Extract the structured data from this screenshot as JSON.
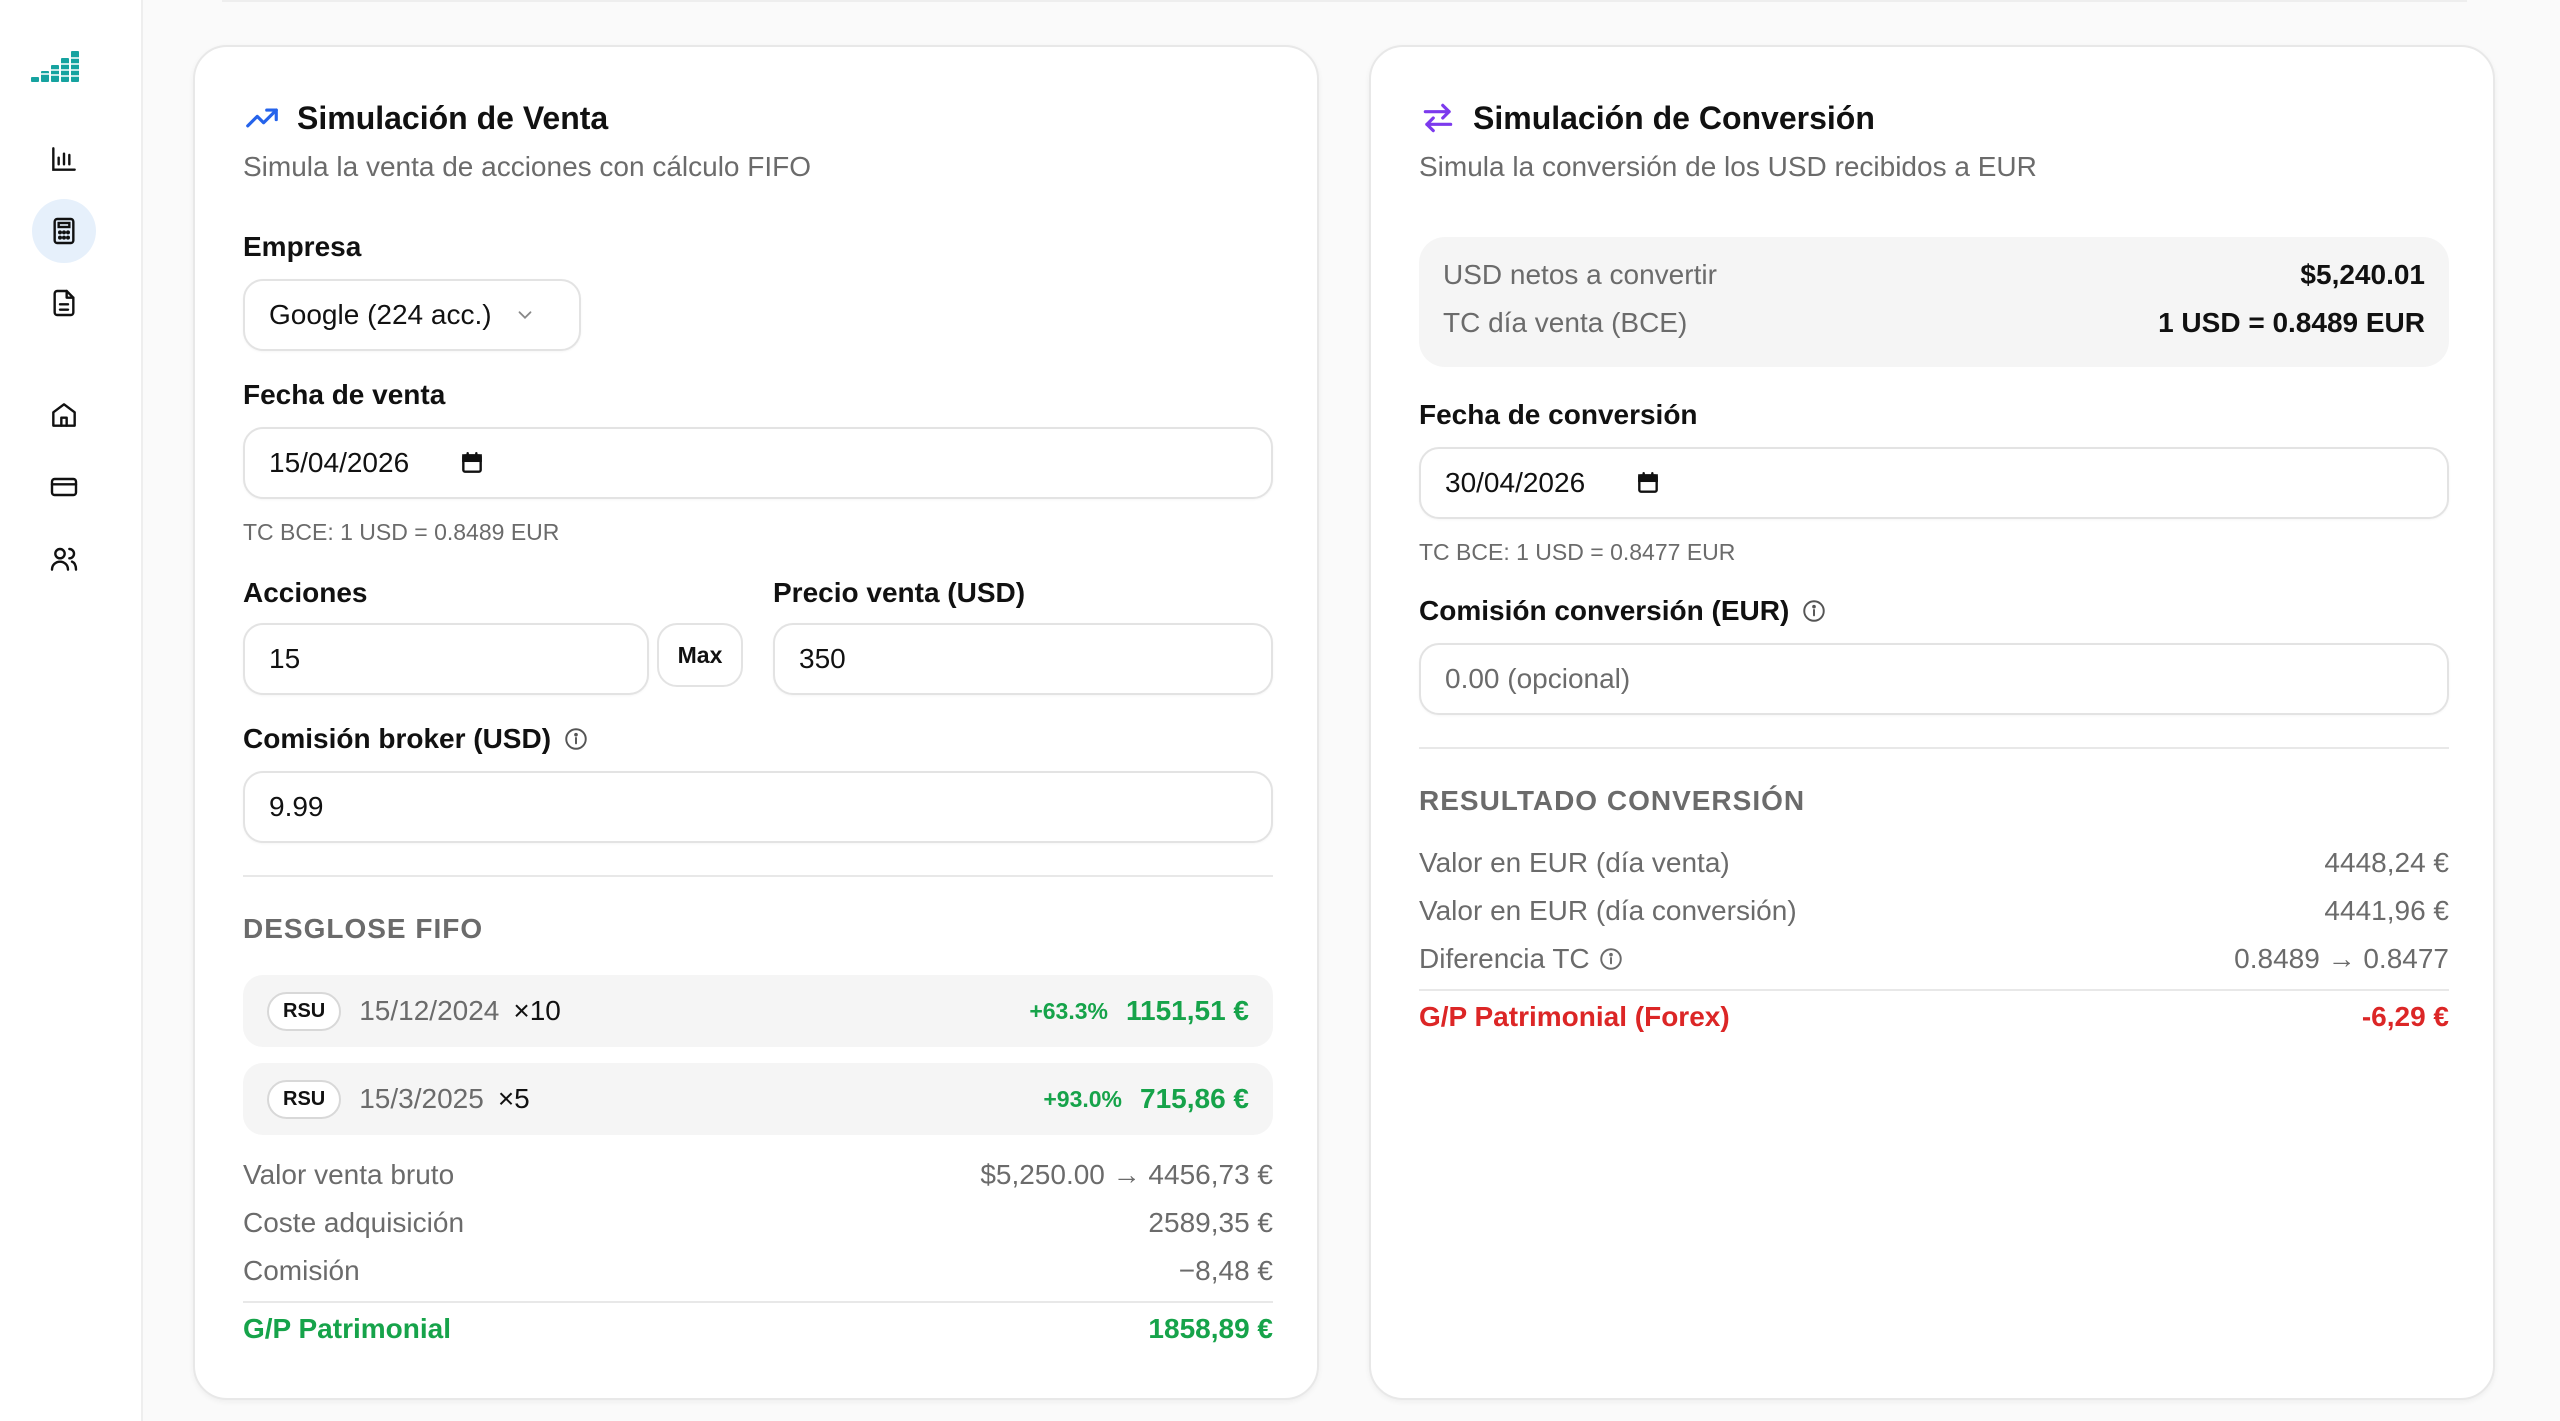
{
  "sidebar": {
    "items": [
      {
        "icon": "bar-chart-icon",
        "active": false
      },
      {
        "icon": "calculator-icon",
        "active": true
      },
      {
        "icon": "document-icon",
        "active": false
      },
      {
        "icon": "home-icon",
        "active": false
      },
      {
        "icon": "credit-card-icon",
        "active": false
      },
      {
        "icon": "users-icon",
        "active": false
      }
    ],
    "brand_color": "#16a3a0"
  },
  "sale": {
    "title": "Simulación de Venta",
    "subtitle": "Simula la venta de acciones con cálculo FIFO",
    "company_label": "Empresa",
    "company_value": "Google (224 acc.)",
    "date_label": "Fecha de venta",
    "date_value": "15/04/2026",
    "rate_hint": "TC BCE: 1 USD = 0.8489 EUR",
    "shares_label": "Acciones",
    "shares_value": "15",
    "max_label": "Max",
    "price_label": "Precio venta (USD)",
    "price_value": "350",
    "fee_label": "Comisión broker (USD)",
    "fee_value": "9.99",
    "fifo_heading": "DESGLOSE FIFO",
    "lots": [
      {
        "type": "RSU",
        "date": "15/12/2024",
        "qty": "×10",
        "pct": "+63.3%",
        "value": "1151,51 €"
      },
      {
        "type": "RSU",
        "date": "15/3/2025",
        "qty": "×5",
        "pct": "+93.0%",
        "value": "715,86 €"
      }
    ],
    "summary": {
      "gross_label": "Valor venta bruto",
      "gross_value": "$5,250.00 → 4456,73 €",
      "cost_label": "Coste adquisición",
      "cost_value": "2589,35 €",
      "fee_label": "Comisión",
      "fee_value": "−8,48 €",
      "total_label": "G/P Patrimonial",
      "total_value": "1858,89 €"
    }
  },
  "conversion": {
    "title": "Simulación de Conversión",
    "subtitle": "Simula la conversión de los USD recibidos a EUR",
    "net_label": "USD netos a convertir",
    "net_value": "$5,240.01",
    "rate_label": "TC día venta (BCE)",
    "rate_value": "1 USD = 0.8489 EUR",
    "date_label": "Fecha de conversión",
    "date_value": "30/04/2026",
    "rate_hint": "TC BCE: 1 USD = 0.8477 EUR",
    "fee_label": "Comisión conversión (EUR)",
    "fee_placeholder": "0.00 (opcional)",
    "result_heading": "RESULTADO CONVERSIÓN",
    "result": {
      "eur_sale_label": "Valor en EUR (día venta)",
      "eur_sale_value": "4448,24 €",
      "eur_conv_label": "Valor en EUR (día conversión)",
      "eur_conv_value": "4441,96 €",
      "diff_label": "Diferencia TC",
      "diff_value": "0.8489 → 0.8477",
      "total_label": "G/P Patrimonial (Forex)",
      "total_value": "-6,29 €"
    }
  },
  "colors": {
    "gain": "#16a34a",
    "loss": "#dc2626",
    "accent_blue": "#2563eb",
    "accent_purple": "#7c3aed"
  }
}
